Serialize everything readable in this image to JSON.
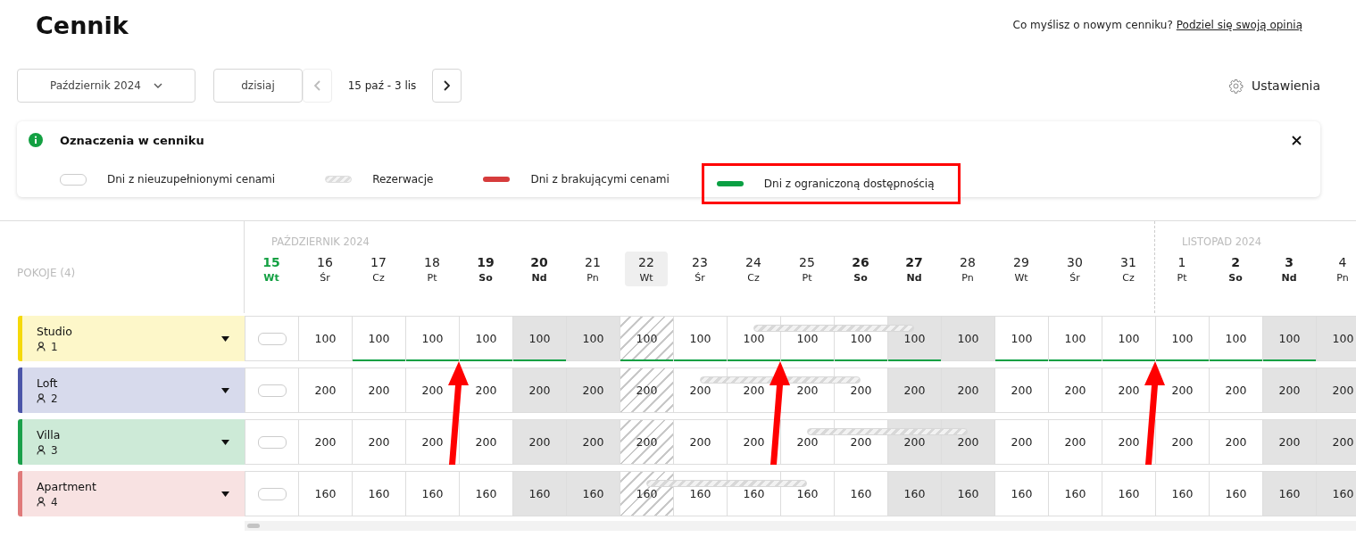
{
  "title": "Cennik",
  "feedback": {
    "question": "Co myślisz o nowym cenniku?",
    "link": "Podziel się swoją opinią"
  },
  "controls": {
    "month": "Październik 2024",
    "today": "dzisiaj",
    "range": "15 paź - 3 lis",
    "prev_disabled": true,
    "settings": "Ustawienia"
  },
  "legend": {
    "title": "Oznaczenia w cenniku",
    "items": [
      {
        "kind": "empty",
        "label": "Dni z nieuzupełnionymi cenami",
        "annotated": false
      },
      {
        "kind": "reservation",
        "label": "Rezerwacje",
        "annotated": false
      },
      {
        "kind": "missing",
        "label": "Dni z brakującymi cenami",
        "annotated": false
      },
      {
        "kind": "limited",
        "label": "Dni z ograniczoną dostępnością",
        "annotated": true
      }
    ]
  },
  "rooms_label": "POKOJE (4)",
  "months": [
    {
      "label": "PAŹDZIERNIK 2024",
      "days": [
        {
          "num": "15",
          "dow": "Wt",
          "today": true,
          "weekend": false,
          "selected": false,
          "shaded": false,
          "hatched": false,
          "arrow": false
        },
        {
          "num": "16",
          "dow": "Śr",
          "today": false,
          "weekend": false,
          "selected": false,
          "shaded": false,
          "hatched": false,
          "arrow": false
        },
        {
          "num": "17",
          "dow": "Cz",
          "today": false,
          "weekend": false,
          "selected": false,
          "shaded": false,
          "hatched": false,
          "arrow": false
        },
        {
          "num": "18",
          "dow": "Pt",
          "today": false,
          "weekend": false,
          "selected": false,
          "shaded": false,
          "hatched": false,
          "arrow": false
        },
        {
          "num": "19",
          "dow": "So",
          "today": false,
          "weekend": true,
          "selected": false,
          "shaded": false,
          "hatched": false,
          "arrow": true
        },
        {
          "num": "20",
          "dow": "Nd",
          "today": false,
          "weekend": true,
          "selected": false,
          "shaded": true,
          "hatched": false,
          "arrow": false
        },
        {
          "num": "21",
          "dow": "Pn",
          "today": false,
          "weekend": false,
          "selected": false,
          "shaded": true,
          "hatched": false,
          "arrow": false
        },
        {
          "num": "22",
          "dow": "Wt",
          "today": false,
          "weekend": false,
          "selected": true,
          "shaded": false,
          "hatched": true,
          "arrow": false
        },
        {
          "num": "23",
          "dow": "Śr",
          "today": false,
          "weekend": false,
          "selected": false,
          "shaded": false,
          "hatched": false,
          "arrow": false
        },
        {
          "num": "24",
          "dow": "Cz",
          "today": false,
          "weekend": false,
          "selected": false,
          "shaded": false,
          "hatched": false,
          "arrow": false
        },
        {
          "num": "25",
          "dow": "Pt",
          "today": false,
          "weekend": false,
          "selected": false,
          "shaded": false,
          "hatched": false,
          "arrow": true
        },
        {
          "num": "26",
          "dow": "So",
          "today": false,
          "weekend": true,
          "selected": false,
          "shaded": false,
          "hatched": false,
          "arrow": false
        },
        {
          "num": "27",
          "dow": "Nd",
          "today": false,
          "weekend": true,
          "selected": false,
          "shaded": true,
          "hatched": false,
          "arrow": false
        },
        {
          "num": "28",
          "dow": "Pn",
          "today": false,
          "weekend": false,
          "selected": false,
          "shaded": true,
          "hatched": false,
          "arrow": false
        },
        {
          "num": "29",
          "dow": "Wt",
          "today": false,
          "weekend": false,
          "selected": false,
          "shaded": false,
          "hatched": false,
          "arrow": false
        },
        {
          "num": "30",
          "dow": "Śr",
          "today": false,
          "weekend": false,
          "selected": false,
          "shaded": false,
          "hatched": false,
          "arrow": false
        },
        {
          "num": "31",
          "dow": "Cz",
          "today": false,
          "weekend": false,
          "selected": false,
          "shaded": false,
          "hatched": false,
          "arrow": false
        }
      ]
    },
    {
      "label": "LISTOPAD 2024",
      "days": [
        {
          "num": "1",
          "dow": "Pt",
          "today": false,
          "weekend": false,
          "selected": false,
          "shaded": false,
          "hatched": false,
          "arrow": true
        },
        {
          "num": "2",
          "dow": "So",
          "today": false,
          "weekend": true,
          "selected": false,
          "shaded": false,
          "hatched": false,
          "arrow": false
        },
        {
          "num": "3",
          "dow": "Nd",
          "today": false,
          "weekend": true,
          "selected": false,
          "shaded": true,
          "hatched": false,
          "arrow": false
        },
        {
          "num": "4",
          "dow": "Pn",
          "today": false,
          "weekend": false,
          "selected": false,
          "shaded": true,
          "hatched": false,
          "arrow": false
        }
      ]
    }
  ],
  "rows": [
    {
      "name": "Studio",
      "guests": "1",
      "color": "#f5d90a",
      "cells": [
        {
          "kind": "empty"
        },
        {
          "kind": "price",
          "price": "100",
          "limited": false,
          "booked": false
        },
        {
          "kind": "price",
          "price": "100",
          "limited": true,
          "booked": false
        },
        {
          "kind": "price",
          "price": "100",
          "limited": true,
          "booked": false
        },
        {
          "kind": "price",
          "price": "100",
          "limited": true,
          "booked": false
        },
        {
          "kind": "price",
          "price": "100",
          "limited": true,
          "booked": false
        },
        {
          "kind": "price",
          "price": "100",
          "limited": false,
          "booked": false
        },
        {
          "kind": "price",
          "price": "100",
          "limited": true,
          "booked": false
        },
        {
          "kind": "price",
          "price": "100",
          "limited": true,
          "booked": false
        },
        {
          "kind": "price",
          "price": "100",
          "limited": true,
          "booked": true
        },
        {
          "kind": "price",
          "price": "100",
          "limited": true,
          "booked": true
        },
        {
          "kind": "price",
          "price": "100",
          "limited": true,
          "booked": true
        },
        {
          "kind": "price",
          "price": "100",
          "limited": true,
          "booked": false
        },
        {
          "kind": "price",
          "price": "100",
          "limited": false,
          "booked": false
        },
        {
          "kind": "price",
          "price": "100",
          "limited": true,
          "booked": false
        },
        {
          "kind": "price",
          "price": "100",
          "limited": true,
          "booked": false
        },
        {
          "kind": "price",
          "price": "100",
          "limited": true,
          "booked": false
        },
        {
          "kind": "price",
          "price": "100",
          "limited": true,
          "booked": false
        },
        {
          "kind": "price",
          "price": "100",
          "limited": true,
          "booked": false
        },
        {
          "kind": "price",
          "price": "100",
          "limited": true,
          "booked": false
        },
        {
          "kind": "price",
          "price": "100",
          "limited": false,
          "booked": false
        }
      ]
    },
    {
      "name": "Loft",
      "guests": "2",
      "color": "#4b55a8",
      "cells": [
        {
          "kind": "empty"
        },
        {
          "kind": "price",
          "price": "200",
          "limited": false,
          "booked": false
        },
        {
          "kind": "price",
          "price": "200",
          "limited": false,
          "booked": false
        },
        {
          "kind": "price",
          "price": "200",
          "limited": false,
          "booked": false
        },
        {
          "kind": "price",
          "price": "200",
          "limited": false,
          "booked": false
        },
        {
          "kind": "price",
          "price": "200",
          "limited": false,
          "booked": false
        },
        {
          "kind": "price",
          "price": "200",
          "limited": false,
          "booked": false
        },
        {
          "kind": "price",
          "price": "200",
          "limited": false,
          "booked": false
        },
        {
          "kind": "price",
          "price": "200",
          "limited": false,
          "booked": true
        },
        {
          "kind": "price",
          "price": "200",
          "limited": false,
          "booked": true
        },
        {
          "kind": "price",
          "price": "200",
          "limited": false,
          "booked": true
        },
        {
          "kind": "price",
          "price": "200",
          "limited": false,
          "booked": false
        },
        {
          "kind": "price",
          "price": "200",
          "limited": false,
          "booked": false
        },
        {
          "kind": "price",
          "price": "200",
          "limited": false,
          "booked": false
        },
        {
          "kind": "price",
          "price": "200",
          "limited": false,
          "booked": false
        },
        {
          "kind": "price",
          "price": "200",
          "limited": false,
          "booked": false
        },
        {
          "kind": "price",
          "price": "200",
          "limited": false,
          "booked": false
        },
        {
          "kind": "price",
          "price": "200",
          "limited": false,
          "booked": false
        },
        {
          "kind": "price",
          "price": "200",
          "limited": false,
          "booked": false
        },
        {
          "kind": "price",
          "price": "200",
          "limited": false,
          "booked": false
        },
        {
          "kind": "price",
          "price": "200",
          "limited": false,
          "booked": false
        }
      ]
    },
    {
      "name": "Villa",
      "guests": "3",
      "color": "#1aa04a",
      "cells": [
        {
          "kind": "empty"
        },
        {
          "kind": "price",
          "price": "200",
          "limited": false,
          "booked": false
        },
        {
          "kind": "price",
          "price": "200",
          "limited": false,
          "booked": false
        },
        {
          "kind": "price",
          "price": "200",
          "limited": false,
          "booked": false
        },
        {
          "kind": "price",
          "price": "200",
          "limited": false,
          "booked": false
        },
        {
          "kind": "price",
          "price": "200",
          "limited": false,
          "booked": false
        },
        {
          "kind": "price",
          "price": "200",
          "limited": false,
          "booked": false
        },
        {
          "kind": "price",
          "price": "200",
          "limited": false,
          "booked": false
        },
        {
          "kind": "price",
          "price": "200",
          "limited": false,
          "booked": false
        },
        {
          "kind": "price",
          "price": "200",
          "limited": false,
          "booked": false
        },
        {
          "kind": "price",
          "price": "200",
          "limited": false,
          "booked": true
        },
        {
          "kind": "price",
          "price": "200",
          "limited": false,
          "booked": true
        },
        {
          "kind": "price",
          "price": "200",
          "limited": false,
          "booked": true
        },
        {
          "kind": "price",
          "price": "200",
          "limited": false,
          "booked": false
        },
        {
          "kind": "price",
          "price": "200",
          "limited": false,
          "booked": false
        },
        {
          "kind": "price",
          "price": "200",
          "limited": false,
          "booked": false
        },
        {
          "kind": "price",
          "price": "200",
          "limited": false,
          "booked": false
        },
        {
          "kind": "price",
          "price": "200",
          "limited": false,
          "booked": false
        },
        {
          "kind": "price",
          "price": "200",
          "limited": false,
          "booked": false
        },
        {
          "kind": "price",
          "price": "200",
          "limited": false,
          "booked": false
        },
        {
          "kind": "price",
          "price": "200",
          "limited": false,
          "booked": false
        }
      ]
    },
    {
      "name": "Apartment",
      "guests": "4",
      "color": "#e07a7a",
      "cells": [
        {
          "kind": "empty"
        },
        {
          "kind": "price",
          "price": "160",
          "limited": false,
          "booked": false
        },
        {
          "kind": "price",
          "price": "160",
          "limited": false,
          "booked": false
        },
        {
          "kind": "price",
          "price": "160",
          "limited": false,
          "booked": false
        },
        {
          "kind": "price",
          "price": "160",
          "limited": false,
          "booked": false
        },
        {
          "kind": "price",
          "price": "160",
          "limited": false,
          "booked": false
        },
        {
          "kind": "price",
          "price": "160",
          "limited": false,
          "booked": false
        },
        {
          "kind": "price",
          "price": "160",
          "limited": false,
          "booked": true
        },
        {
          "kind": "price",
          "price": "160",
          "limited": false,
          "booked": true
        },
        {
          "kind": "price",
          "price": "160",
          "limited": false,
          "booked": true
        },
        {
          "kind": "price",
          "price": "160",
          "limited": false,
          "booked": false
        },
        {
          "kind": "price",
          "price": "160",
          "limited": false,
          "booked": false
        },
        {
          "kind": "price",
          "price": "160",
          "limited": false,
          "booked": false
        },
        {
          "kind": "price",
          "price": "160",
          "limited": false,
          "booked": false
        },
        {
          "kind": "price",
          "price": "160",
          "limited": false,
          "booked": false
        },
        {
          "kind": "price",
          "price": "160",
          "limited": false,
          "booked": false
        },
        {
          "kind": "price",
          "price": "160",
          "limited": false,
          "booked": false
        },
        {
          "kind": "price",
          "price": "160",
          "limited": false,
          "booked": false
        },
        {
          "kind": "price",
          "price": "160",
          "limited": false,
          "booked": false
        },
        {
          "kind": "price",
          "price": "160",
          "limited": false,
          "booked": false
        },
        {
          "kind": "price",
          "price": "160",
          "limited": false,
          "booked": false
        }
      ]
    }
  ]
}
